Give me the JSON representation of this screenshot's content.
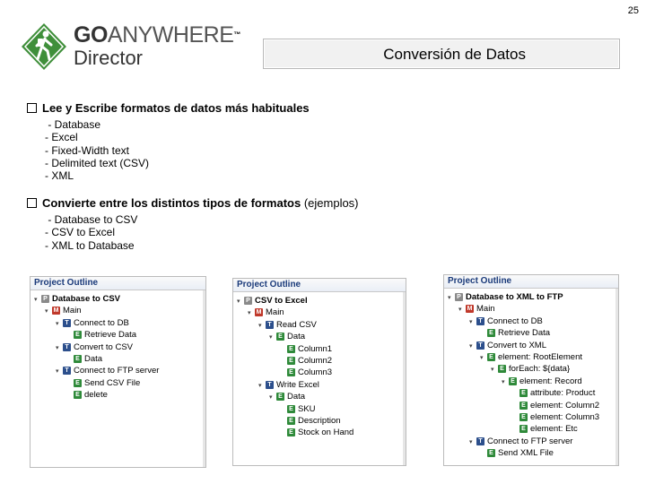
{
  "page_number": "25",
  "logo": {
    "brand_go": "GO",
    "brand_anywhere": "ANYWHERE",
    "trademark": "™",
    "product": "Director"
  },
  "title": "Conversión de Datos",
  "section1": {
    "heading": "Lee y Escribe formatos de datos más habituales",
    "items": [
      " - Database",
      "- Excel",
      "- Fixed-Width text",
      "- Delimited text (CSV)",
      "- XML"
    ]
  },
  "section2": {
    "heading": "Convierte entre los distintos tipos de formatos",
    "heading_extra": " (ejemplos)",
    "items": [
      " - Database to CSV",
      "- CSV to Excel",
      "- XML to Database"
    ]
  },
  "panels": [
    {
      "header": "Project Outline",
      "rows": [
        {
          "toggle": "▾",
          "icon": "P",
          "label": "Database to CSV",
          "bold": true
        },
        {
          "toggle": "▾",
          "icon": "M",
          "label": "Main"
        },
        {
          "toggle": "▾",
          "icon": "T",
          "label": "Connect to DB"
        },
        {
          "toggle": "",
          "icon": "E",
          "label": "Retrieve Data"
        },
        {
          "toggle": "▾",
          "icon": "T",
          "label": "Convert to CSV"
        },
        {
          "toggle": "",
          "icon": "E",
          "label": "Data"
        },
        {
          "toggle": "▾",
          "icon": "T",
          "label": "Connect to FTP server"
        },
        {
          "toggle": "",
          "icon": "E",
          "label": "Send CSV File"
        },
        {
          "toggle": "",
          "icon": "E",
          "label": "delete"
        }
      ]
    },
    {
      "header": "Project Outline",
      "rows": [
        {
          "toggle": "▾",
          "icon": "P",
          "label": "CSV to Excel",
          "bold": true
        },
        {
          "toggle": "▾",
          "icon": "M",
          "label": "Main"
        },
        {
          "toggle": "▾",
          "icon": "T",
          "label": "Read CSV"
        },
        {
          "toggle": "▾",
          "icon": "E",
          "label": "Data"
        },
        {
          "toggle": "",
          "icon": "E",
          "label": "Column1"
        },
        {
          "toggle": "",
          "icon": "E",
          "label": "Column2"
        },
        {
          "toggle": "",
          "icon": "E",
          "label": "Column3"
        },
        {
          "toggle": "▾",
          "icon": "T",
          "label": "Write Excel"
        },
        {
          "toggle": "▾",
          "icon": "E",
          "label": "Data"
        },
        {
          "toggle": "",
          "icon": "E",
          "label": "SKU"
        },
        {
          "toggle": "",
          "icon": "E",
          "label": "Description"
        },
        {
          "toggle": "",
          "icon": "E",
          "label": "Stock on Hand"
        }
      ]
    },
    {
      "header": "Project Outline",
      "rows": [
        {
          "toggle": "▾",
          "icon": "P",
          "label": "Database to XML to FTP",
          "bold": true
        },
        {
          "toggle": "▾",
          "icon": "M",
          "label": "Main"
        },
        {
          "toggle": "▾",
          "icon": "T",
          "label": "Connect to DB"
        },
        {
          "toggle": "",
          "icon": "E",
          "label": "Retrieve Data"
        },
        {
          "toggle": "▾",
          "icon": "T",
          "label": "Convert to XML"
        },
        {
          "toggle": "▾",
          "icon": "E",
          "label": "element: RootElement"
        },
        {
          "toggle": "▾",
          "icon": "E",
          "label": "forEach: ${data}"
        },
        {
          "toggle": "▾",
          "icon": "E",
          "label": "element: Record"
        },
        {
          "toggle": "",
          "icon": "E",
          "label": "attribute: Product"
        },
        {
          "toggle": "",
          "icon": "E",
          "label": "element: Column2"
        },
        {
          "toggle": "",
          "icon": "E",
          "label": "element: Column3"
        },
        {
          "toggle": "",
          "icon": "E",
          "label": "element: Etc"
        },
        {
          "toggle": "▾",
          "icon": "T",
          "label": "Connect to FTP server"
        },
        {
          "toggle": "",
          "icon": "E",
          "label": "Send XML File"
        }
      ]
    }
  ]
}
